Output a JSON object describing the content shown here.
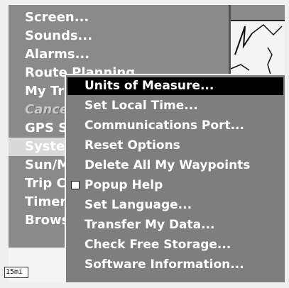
{
  "main_menu": {
    "items": [
      {
        "label": "Screen..."
      },
      {
        "label": "Sounds..."
      },
      {
        "label": "Alarms..."
      },
      {
        "label": "Route Planning..."
      },
      {
        "label": "My Trips..."
      },
      {
        "label": "Cancel Navigation"
      },
      {
        "label": "GPS Setup..."
      },
      {
        "label": "System Setup..."
      },
      {
        "label": "Sun/Moon Calc..."
      },
      {
        "label": "Trip Calculator..."
      },
      {
        "label": "Timers..."
      },
      {
        "label": "Browse Files..."
      }
    ],
    "selected_index": 7,
    "dimmed_index": 5
  },
  "popup": {
    "items": [
      {
        "label": "Units of Measure..."
      },
      {
        "label": "Set Local Time..."
      },
      {
        "label": "Communications Port..."
      },
      {
        "label": "Reset Options"
      },
      {
        "label": "Delete All My Waypoints"
      },
      {
        "label": "Popup Help",
        "checkbox": true,
        "checked": false
      },
      {
        "label": "Set Language..."
      },
      {
        "label": "Transfer My Data..."
      },
      {
        "label": "Check Free Storage..."
      },
      {
        "label": "Software Information..."
      }
    ],
    "selected_index": 0
  },
  "map": {
    "scale_label": "15mi",
    "icon": "map-preview-icon"
  },
  "colors": {
    "screen_bg": "#8a8a8a",
    "popup_bg": "#7e7e7e",
    "highlight": "#000000",
    "text": "#ffffff"
  }
}
